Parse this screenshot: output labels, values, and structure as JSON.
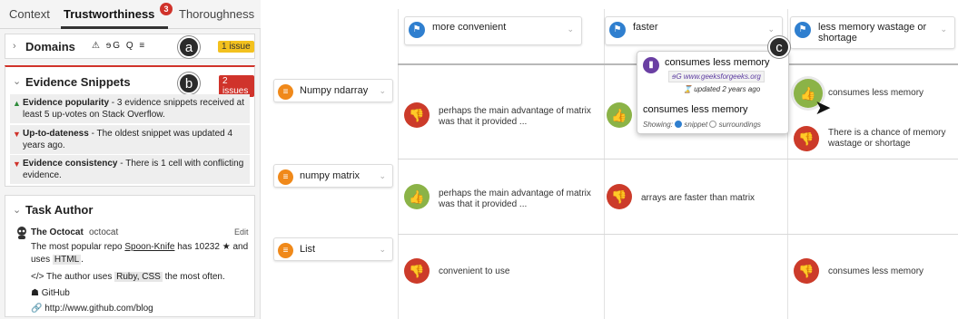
{
  "tabs": [
    {
      "label": "Context"
    },
    {
      "label": "Trustworthiness",
      "badge": "3"
    },
    {
      "label": "Thoroughness"
    }
  ],
  "domains": {
    "title": "Domains",
    "source_icons": "⚠ ɘG Q ≡",
    "issue": "1 issue",
    "marker": "a"
  },
  "evidence": {
    "title": "Evidence Snippets",
    "issue": "2 issues",
    "marker": "b",
    "rows": [
      {
        "direction": "up",
        "bold": "Evidence popularity",
        "text": " - 3 evidence snippets received at least 5 up-votes on Stack Overflow."
      },
      {
        "direction": "down",
        "bold": "Up-to-dateness",
        "text": " - The oldest snippet was updated 4 years ago."
      },
      {
        "direction": "down",
        "bold": "Evidence consistency",
        "text": " - There is 1 cell with conflicting evidence."
      }
    ]
  },
  "author": {
    "title": "Task Author",
    "name": "The Octocat",
    "handle": "octocat",
    "edit": "Edit",
    "repo_prefix": "The most popular repo ",
    "repo_name": "Spoon-Knife",
    "repo_suffix": " has 10232 ★ and",
    "uses_prefix": "uses ",
    "uses_lang": "HTML",
    "uses_suffix": ".",
    "languages_prefix": "</> The author uses ",
    "languages": "Ruby, CSS",
    "languages_suffix": " the most often.",
    "github": "GitHub",
    "blog": "http://www.github.com/blog"
  },
  "columns": [
    {
      "label": "more convenient"
    },
    {
      "label": "faster"
    },
    {
      "label": "less memory wastage or shortage"
    }
  ],
  "rows": [
    {
      "label": "Numpy ndarray"
    },
    {
      "label": "numpy matrix"
    },
    {
      "label": "List"
    }
  ],
  "cells": {
    "r1c1": "perhaps the main advantage of matrix was that it provided ...",
    "r1c3a": "consumes less memory",
    "r1c3b": "There is a chance of memory wastage or shortage",
    "r2c1": "perhaps the main advantage of matrix was that it provided ...",
    "r2c2": "arrays are faster than matrix",
    "r3c1": "convenient to use",
    "r3c3": "consumes less memory"
  },
  "tooltip": {
    "title": "consumes less memory",
    "site_icon": "ɘG",
    "site": "www.geeksforgeeks.org",
    "updated": "updated 2 years ago",
    "snippet": "consumes less memory",
    "showing_label": "Showing:",
    "opt_snippet": "snippet",
    "opt_surroundings": "surroundings",
    "marker": "c"
  },
  "colors": {
    "accent_red": "#d0332b",
    "thumb_up": "#8bb347",
    "thumb_down": "#cc3b2a",
    "flag_blue": "#2f7fcf",
    "list_orange": "#f0891a"
  }
}
